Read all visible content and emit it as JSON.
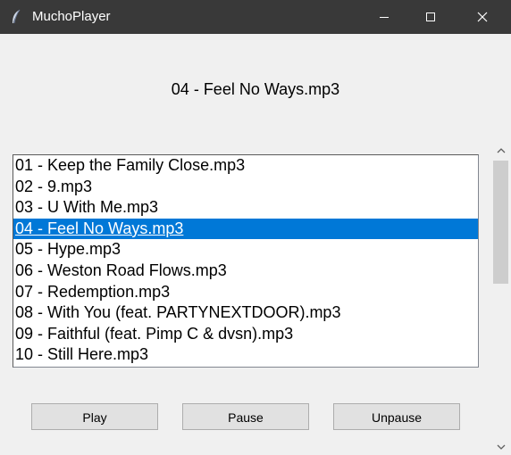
{
  "window": {
    "title": "MuchoPlayer",
    "icon": "feather-icon"
  },
  "now_playing": "04 - Feel No Ways.mp3",
  "playlist": {
    "selected_index": 3,
    "items": [
      "01 - Keep the Family Close.mp3",
      "02 - 9.mp3",
      "03 - U With Me.mp3",
      "04 - Feel No Ways.mp3",
      "05 - Hype.mp3",
      "06 - Weston Road Flows.mp3",
      "07 - Redemption.mp3",
      "08 - With You (feat. PARTYNEXTDOOR).mp3",
      "09 - Faithful (feat. Pimp C & dvsn).mp3",
      "10 - Still Here.mp3"
    ]
  },
  "controls": {
    "play": "Play",
    "pause": "Pause",
    "unpause": "Unpause"
  },
  "colors": {
    "titlebar": "#393939",
    "selection": "#0078d7",
    "background": "#f0f0f0"
  }
}
